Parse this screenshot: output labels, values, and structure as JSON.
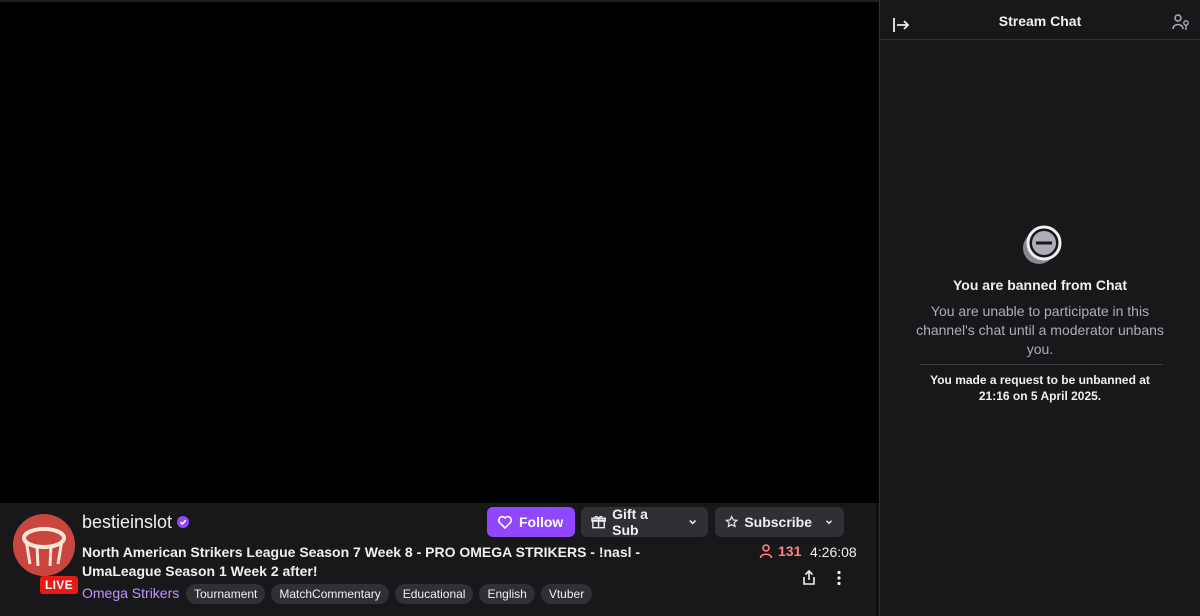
{
  "stream": {
    "channel_name": "bestieinslot",
    "live_label": "LIVE",
    "title": "North American Strikers League Season 7 Week 8 - PRO OMEGA STRIKERS - !nasl - UmaLeague Season 1 Week 2 after!",
    "game": "Omega Strikers",
    "tags": [
      "Tournament",
      "MatchCommentary",
      "Educational",
      "English",
      "Vtuber"
    ],
    "viewer_count": "131",
    "uptime": "4:26:08"
  },
  "actions": {
    "follow_label": "Follow",
    "gift_label": "Gift a Sub",
    "subscribe_label": "Subscribe"
  },
  "chat": {
    "title": "Stream Chat",
    "ban_title": "You are banned from Chat",
    "ban_desc": "You are unable to participate in this channel's chat until a moderator unbans you.",
    "unban_note": "You made a request to be unbanned at 21:16 on 5 April 2025."
  },
  "colors": {
    "accent": "#9147ff",
    "live": "#e91916",
    "viewers": "#ff8280",
    "game_link": "#bf94ff"
  }
}
